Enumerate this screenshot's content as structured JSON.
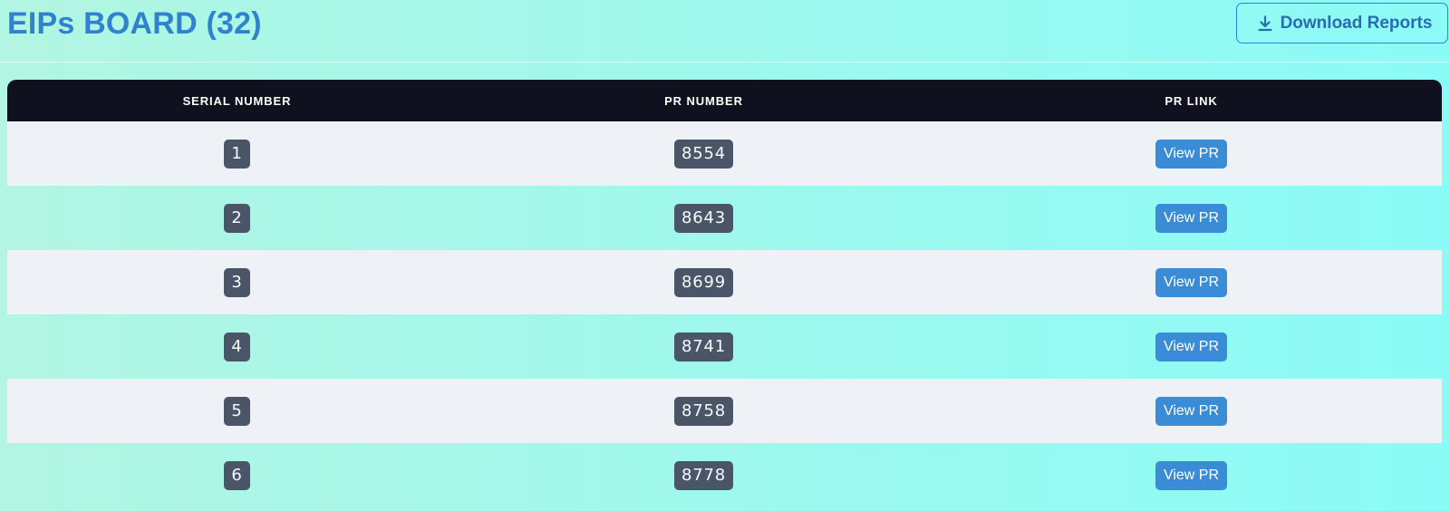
{
  "header": {
    "title": "EIPs BOARD (32)",
    "download_label": "Download Reports",
    "download_icon": "download-icon"
  },
  "table": {
    "columns": [
      "SERIAL NUMBER",
      "PR NUMBER",
      "PR LINK"
    ],
    "rows": [
      {
        "serial": "1",
        "pr_number": "8554",
        "link_label": "View PR"
      },
      {
        "serial": "2",
        "pr_number": "8643",
        "link_label": "View PR"
      },
      {
        "serial": "3",
        "pr_number": "8699",
        "link_label": "View PR"
      },
      {
        "serial": "4",
        "pr_number": "8741",
        "link_label": "View PR"
      },
      {
        "serial": "5",
        "pr_number": "8758",
        "link_label": "View PR"
      },
      {
        "serial": "6",
        "pr_number": "8778",
        "link_label": "View PR"
      }
    ]
  },
  "colors": {
    "accent": "#3182ce",
    "header_bg": "#0f121e",
    "badge_bg": "#4a5568",
    "button_bg": "#3b8cd6",
    "row_alt_bg": "#eef2f7"
  }
}
